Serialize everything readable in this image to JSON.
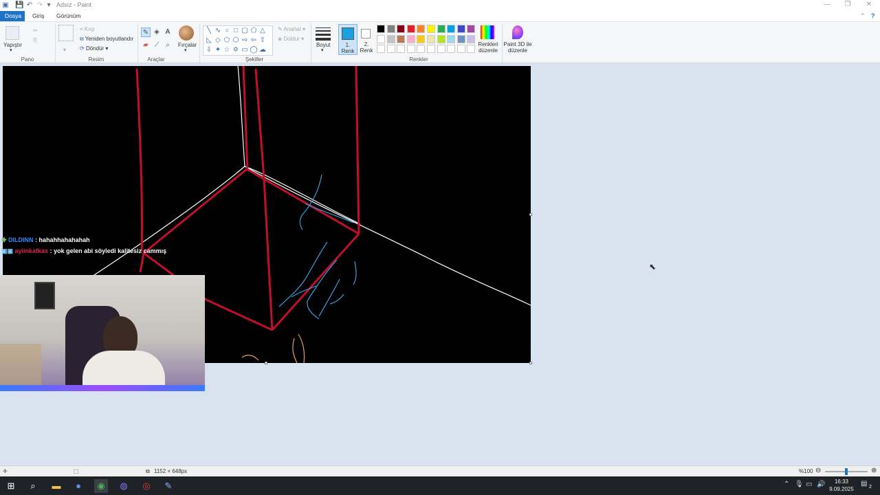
{
  "window": {
    "title": "Adsız - Paint",
    "minimize": "—",
    "restore": "❐",
    "close": "✕"
  },
  "tabs": [
    "Dosya",
    "Giriş",
    "Görünüm"
  ],
  "ribbon": {
    "clipboard": {
      "paste_label": "Yapıştır",
      "group_label": "Pano"
    },
    "image": {
      "crop_label": "Kırp",
      "resize_label": "Yeniden boyutlandır",
      "rotate_label": "Döndür",
      "group_label": "Resim"
    },
    "tools": {
      "group_label": "Araçlar"
    },
    "brushes": {
      "label": "Fırçalar"
    },
    "shapes": {
      "outline_label": "Anahat",
      "fill_label": "Doldur",
      "group_label": "Şekiller"
    },
    "size": {
      "label": "Boyut"
    },
    "color1": {
      "label_num": "1.",
      "label": "Renk",
      "color": "#1ba1e2"
    },
    "color2": {
      "label_num": "2.",
      "label": "Renk",
      "color": "#ffffff"
    },
    "palette_row1": [
      "#000000",
      "#7f7f7f",
      "#880015",
      "#ed1c24",
      "#ff7f27",
      "#fff200",
      "#22b14c",
      "#00a2e8",
      "#3f48cc",
      "#a349a4"
    ],
    "palette_row2": [
      "#ffffff",
      "#c3c3c3",
      "#b97a57",
      "#ffaec9",
      "#ffc90e",
      "#efe4b0",
      "#b5e61d",
      "#99d9ea",
      "#7092be",
      "#c8bfe7"
    ],
    "palette_row3": [
      "#ffffff",
      "#ffffff",
      "#ffffff",
      "#ffffff",
      "#ffffff",
      "#ffffff",
      "#ffffff",
      "#ffffff",
      "#ffffff",
      "#ffffff"
    ],
    "edit_colors_label": "Renkleri düzenle",
    "paint3d_label": "Paint 3D ile düzenle",
    "colors_group_label": "Renkler"
  },
  "chat": [
    {
      "user": "DILDINN",
      "message": ": hahahhahahahah"
    },
    {
      "user": "aylinkafkas",
      "message": ": yok gelen abi söyledi kalitesiz cammış"
    }
  ],
  "status": {
    "dimensions": "1152 × 648px",
    "zoom": "%100",
    "zoom_level": 0.5
  },
  "taskbar": {
    "time": "16:33",
    "date": "9.09.2025",
    "notification_count": "2"
  },
  "colors": {
    "accent": "#1e73c4",
    "canvas": "#000000",
    "red_line": "#c0102a",
    "white_line": "#ffffff",
    "blue_scribble": "#3aa0e0",
    "orange_scribble": "#f0a050"
  }
}
